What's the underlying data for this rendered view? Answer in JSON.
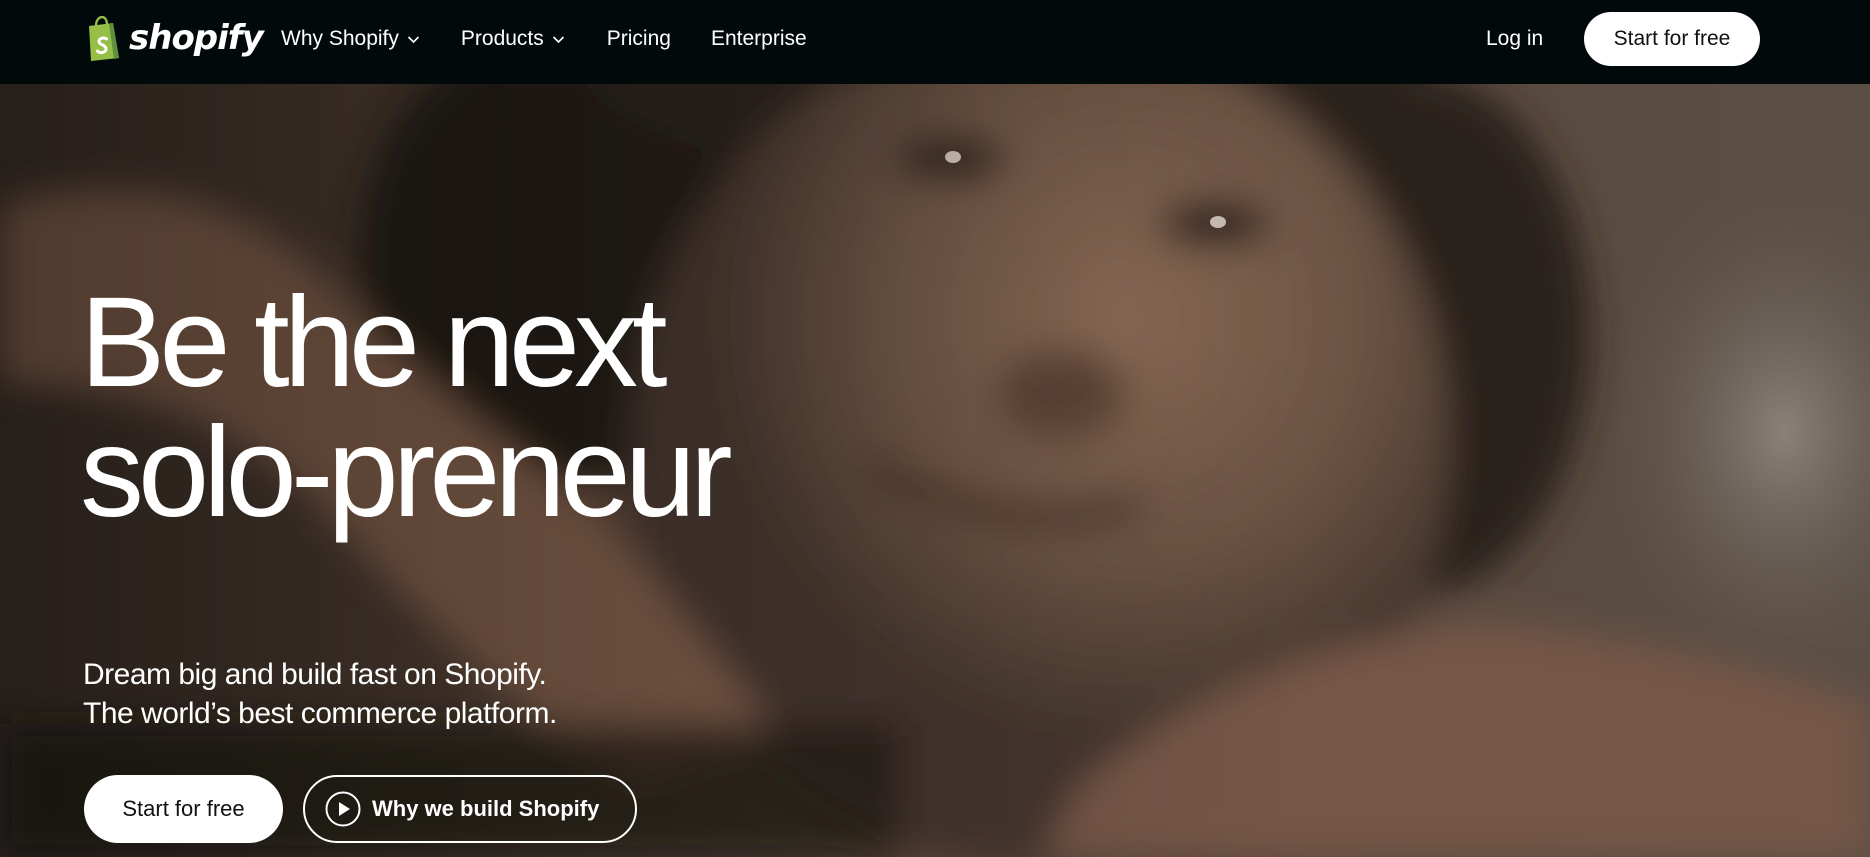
{
  "brand": {
    "name": "shopify",
    "logo_icon": "shopify-bag-logo",
    "accent_green": "#95bf47",
    "nav_background": "#02090b"
  },
  "nav": {
    "items": [
      {
        "label": "Why Shopify",
        "icon": "chevron-down-icon"
      },
      {
        "label": "Products",
        "icon": "chevron-down-icon"
      },
      {
        "label": "Pricing"
      },
      {
        "label": "Enterprise"
      }
    ],
    "login_label": "Log in",
    "cta_label": "Start for free"
  },
  "hero": {
    "headline_line1": "Be the next",
    "headline_line2": "solo-preneur",
    "subhead_line1": "Dream big and build fast on Shopify.",
    "subhead_line2": "The world’s best commerce platform.",
    "primary_cta_label": "Start for free",
    "video_cta_label": "Why we build Shopify",
    "video_cta_icon": "play-icon"
  }
}
